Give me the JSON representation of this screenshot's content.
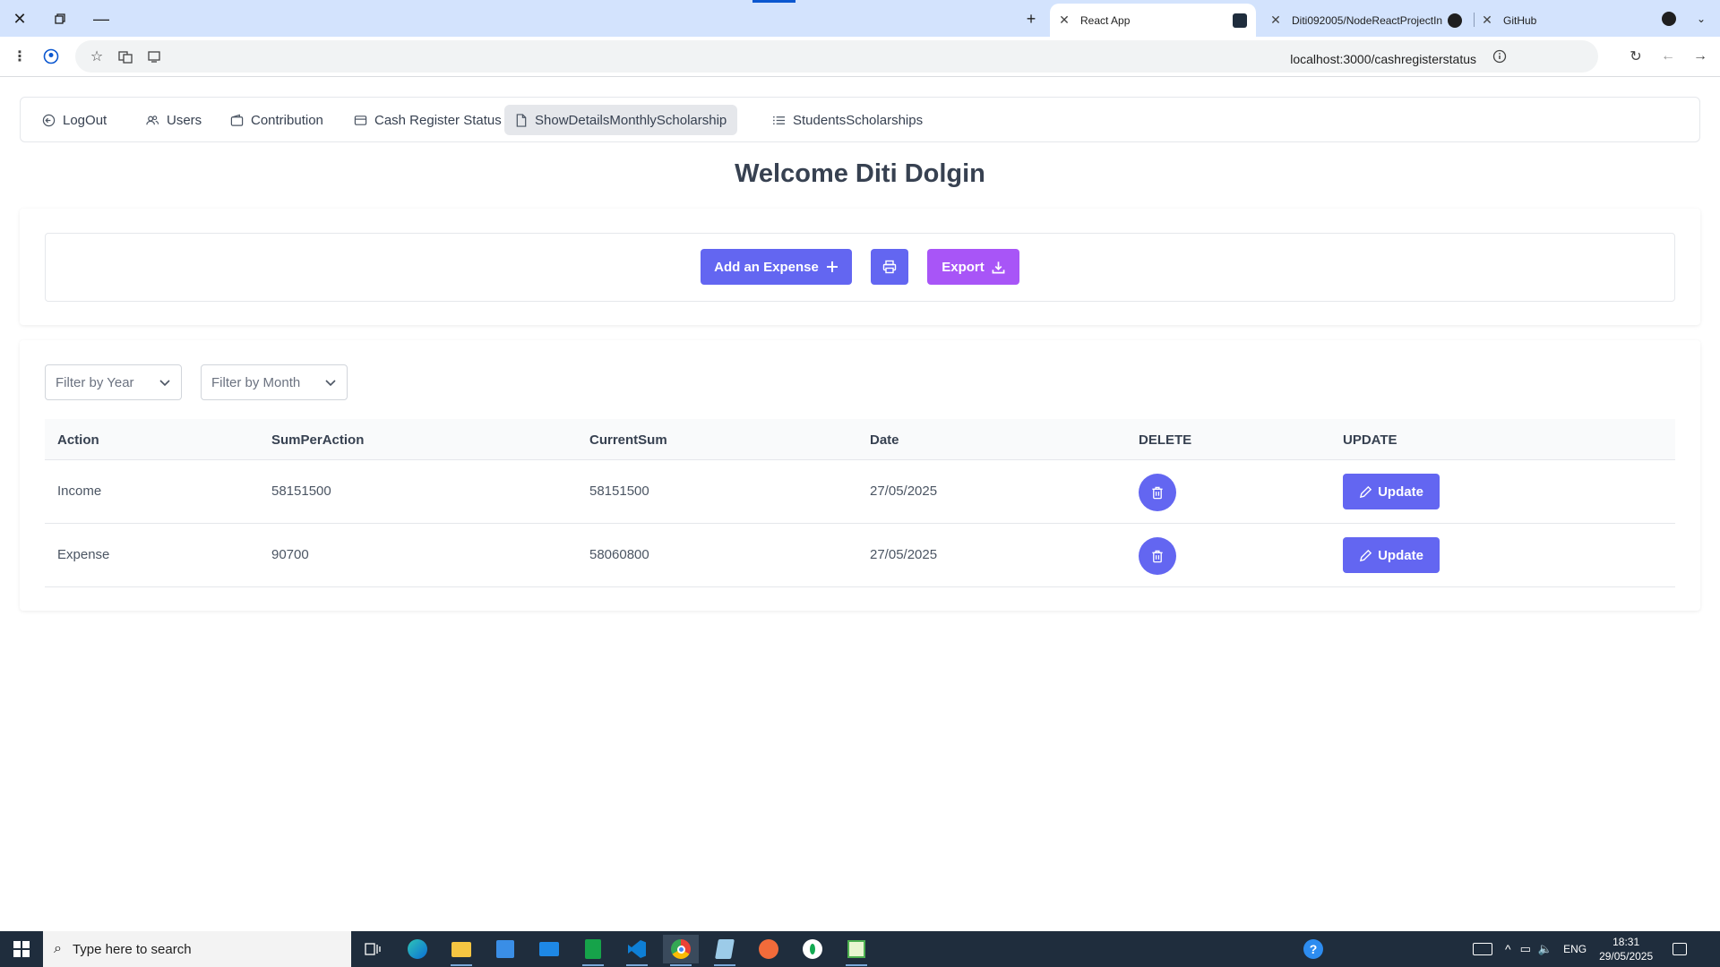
{
  "browser": {
    "tabs": [
      {
        "title": "React App",
        "active": true
      },
      {
        "title": "Diti092005/NodeReactProjectIn",
        "active": false
      },
      {
        "title": "GitHub",
        "active": false
      }
    ],
    "url": "localhost:3000/cashregisterstatus"
  },
  "nav": {
    "items": [
      {
        "label": "LogOut",
        "icon": "logout-icon"
      },
      {
        "label": "Users",
        "icon": "users-icon"
      },
      {
        "label": "Contribution",
        "icon": "wallet-icon"
      },
      {
        "label": "Cash Register Status",
        "icon": "credit-card-icon"
      },
      {
        "label": "ShowDetailsMonthlyScholarship",
        "icon": "file-icon",
        "active": true
      },
      {
        "label": "StudentsScholarships",
        "icon": "list-icon"
      }
    ]
  },
  "welcome": "Welcome Diti Dolgin",
  "actions": {
    "add_expense": "Add an Expense",
    "export": "Export"
  },
  "filters": {
    "year_placeholder": "Filter by Year",
    "month_placeholder": "Filter by Month"
  },
  "table": {
    "headers": [
      "Action",
      "SumPerAction",
      "CurrentSum",
      "Date",
      "DELETE",
      "UPDATE"
    ],
    "rows": [
      {
        "action": "Income",
        "sum_per_action": "58151500",
        "current_sum": "58151500",
        "date": "27/05/2025"
      },
      {
        "action": "Expense",
        "sum_per_action": "90700",
        "current_sum": "58060800",
        "date": "27/05/2025"
      }
    ],
    "update_label": "Update"
  },
  "taskbar": {
    "search_placeholder": "Type here to search",
    "language": "ENG",
    "time": "18:31",
    "date": "29/05/2025"
  },
  "colors": {
    "primary": "#6366f1",
    "export": "#a855f7",
    "tab_strip": "#d3e3fd"
  }
}
